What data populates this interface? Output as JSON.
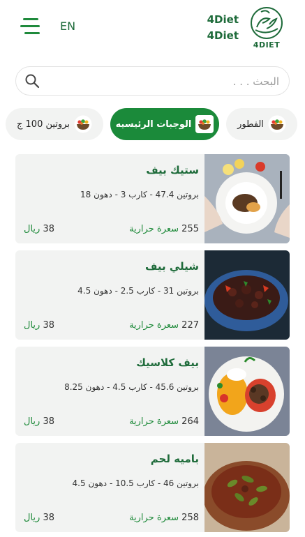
{
  "header": {
    "lang_label": "EN",
    "brand_line1": "4Diet",
    "brand_line2": "4Diet",
    "logo_text": "4DIET"
  },
  "search": {
    "value": "",
    "placeholder": "البحث . . ."
  },
  "categories": [
    {
      "label": "الفطور",
      "active": false
    },
    {
      "label": "الوجبات الرئيسيه",
      "active": true
    },
    {
      "label": "بروتين 100 ج",
      "active": false
    }
  ],
  "meals": [
    {
      "name": "ستيك بيف",
      "macros": "بروتين 47.4 - كارب 3 - دهون 18",
      "calories": "255",
      "calories_unit": "سعرة حرارية",
      "price": "38",
      "currency": "ريال",
      "image_icon": "steak-plate-photo"
    },
    {
      "name": "شيلي بيف",
      "macros": "بروتين 31 - كارب 2.5 - دهون 4.5",
      "calories": "227",
      "calories_unit": "سعرة حرارية",
      "price": "38",
      "currency": "ريال",
      "image_icon": "chili-beef-bowl-photo"
    },
    {
      "name": "بيف كلاسيك",
      "macros": "بروتين 45.6 - كارب 4.5 - دهون 8.25",
      "calories": "264",
      "calories_unit": "سعرة حرارية",
      "price": "38",
      "currency": "ريال",
      "image_icon": "beef-rice-plate-photo"
    },
    {
      "name": "باميه لحم",
      "macros": "بروتين 46 - كارب 10.5 - دهون 4.5",
      "calories": "258",
      "calories_unit": "سعرة حرارية",
      "price": "38",
      "currency": "ريال",
      "image_icon": "okra-stew-photo"
    }
  ],
  "colors": {
    "brand_green": "#1b8a3a",
    "chip_bg": "#f2f3f2",
    "card_bg": "#f2f3f2"
  }
}
